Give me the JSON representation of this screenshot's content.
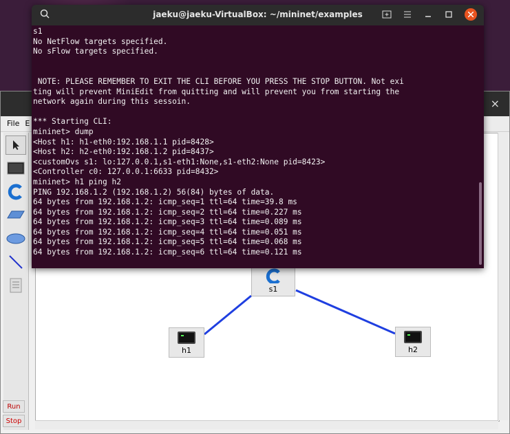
{
  "terminal": {
    "title": "jaeku@jaeku-VirtualBox: ~/mininet/examples",
    "lines": [
      "s1",
      "No NetFlow targets specified.",
      "No sFlow targets specified.",
      "",
      "",
      " NOTE: PLEASE REMEMBER TO EXIT THE CLI BEFORE YOU PRESS THE STOP BUTTON. Not exi",
      "ting will prevent MiniEdit from quitting and will prevent you from starting the",
      "network again during this sessoin.",
      "",
      "*** Starting CLI:",
      "mininet> dump",
      "<Host h1: h1-eth0:192.168.1.1 pid=8428>",
      "<Host h2: h2-eth0:192.168.1.2 pid=8437>",
      "<customOvs s1: lo:127.0.0.1,s1-eth1:None,s1-eth2:None pid=8423>",
      "<Controller c0: 127.0.0.1:6633 pid=8432>",
      "mininet> h1 ping h2",
      "PING 192.168.1.2 (192.168.1.2) 56(84) bytes of data.",
      "64 bytes from 192.168.1.2: icmp_seq=1 ttl=64 time=39.8 ms",
      "64 bytes from 192.168.1.2: icmp_seq=2 ttl=64 time=0.227 ms",
      "64 bytes from 192.168.1.2: icmp_seq=3 ttl=64 time=0.089 ms",
      "64 bytes from 192.168.1.2: icmp_seq=4 ttl=64 time=0.051 ms",
      "64 bytes from 192.168.1.2: icmp_seq=5 ttl=64 time=0.068 ms",
      "64 bytes from 192.168.1.2: icmp_seq=6 ttl=64 time=0.121 ms"
    ],
    "buttons": {
      "search": "search-icon",
      "new_tab": "new-tab-icon",
      "menu": "hamburger-icon",
      "minimize": "minimize-icon",
      "maximize": "maximize-icon",
      "close": "close-icon"
    }
  },
  "miniedit": {
    "menu": [
      "File",
      "E"
    ],
    "close_glyph": "×",
    "tools": [
      "select-icon",
      "host-icon",
      "controller-icon",
      "switch-icon",
      "router-icon",
      "link-icon",
      "netlink-icon"
    ],
    "run_label": "Run",
    "stop_label": "Stop",
    "nodes": {
      "s1": "s1",
      "h1": "h1",
      "h2": "h2"
    }
  },
  "colors": {
    "terminal_bg": "#300a24",
    "link": "#1f3fe0",
    "close_accent": "#e95420"
  }
}
